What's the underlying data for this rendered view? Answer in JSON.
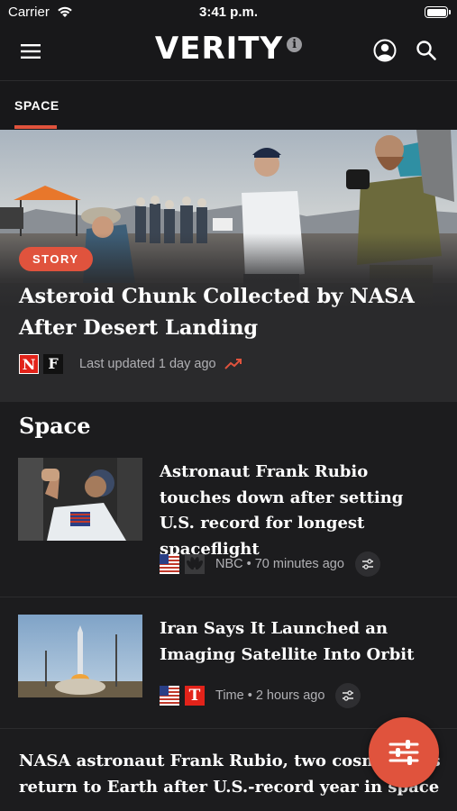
{
  "status_bar": {
    "carrier": "Carrier",
    "time": "3:41 p.m.",
    "icons": [
      "wifi-icon",
      "battery-icon"
    ]
  },
  "header": {
    "logo": "VERITY",
    "logo_info_glyph": "i",
    "icons": [
      "hamburger-menu-icon",
      "account-icon",
      "search-icon"
    ]
  },
  "tabs": [
    {
      "label": "SPACE",
      "active": true
    }
  ],
  "hero": {
    "badge": "STORY",
    "title": "Asteroid Chunk Collected by NASA After Desert Landing",
    "source_logos": [
      "N",
      "F"
    ],
    "updated": "Last updated 1 day ago",
    "trend_icon": "trending-up-icon"
  },
  "section": {
    "title": "Space"
  },
  "articles": [
    {
      "headline": "Astronaut Frank Rubio touches down after setting U.S. record for longest spaceflight",
      "meta": "NBC • 70 minutes ago",
      "source_icons": [
        "us-flag-icon",
        "nbc-peacock-icon"
      ],
      "action_icon": "compare-icon"
    },
    {
      "headline": "Iran Says It Launched an Imaging Satellite Into Orbit",
      "meta": "Time • 2 hours ago",
      "source_icons": [
        "us-flag-icon",
        "time-logo-icon"
      ],
      "time_logo_glyph": "T",
      "action_icon": "compare-icon"
    }
  ],
  "bottom_headline": "NASA astronaut Frank Rubio, two cosmonauts return to Earth after U.S.-record year in space",
  "fab": {
    "icon": "filter-sliders-icon"
  },
  "colors": {
    "accent": "#e0533d",
    "background": "#1c1c1e",
    "meta_text": "#b0b0b4"
  }
}
